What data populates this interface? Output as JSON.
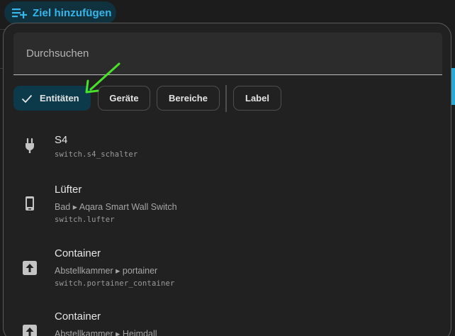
{
  "add_target_button": {
    "label": "Ziel hinzufügen",
    "icon": "playlist-plus-icon",
    "color": "#35b7ec"
  },
  "search": {
    "placeholder": "Durchsuchen"
  },
  "filter_chips": [
    {
      "label": "Entitäten",
      "selected": true
    },
    {
      "label": "Geräte",
      "selected": false
    },
    {
      "label": "Bereiche",
      "selected": false
    },
    {
      "label": "Label",
      "selected": false
    }
  ],
  "results": [
    {
      "name": "S4",
      "subtitle": "",
      "entity_id": "switch.s4_schalter",
      "icon": "power-plug-icon"
    },
    {
      "name": "Lüfter",
      "subtitle": "Bad ▸ Aqara Smart Wall Switch",
      "entity_id": "switch.lufter",
      "icon": "cellphone-icon"
    },
    {
      "name": "Container",
      "subtitle": "Abstellkammer ▸ portainer",
      "entity_id": "switch.portainer_container",
      "icon": "arrow-up-box-icon"
    },
    {
      "name": "Container",
      "subtitle": "Abstellkammer ▸ Heimdall",
      "entity_id": "",
      "icon": "arrow-up-box-icon"
    }
  ],
  "annotation_arrow": {
    "color": "#49e22a"
  },
  "colors": {
    "accent": "#35b7ec",
    "selected_chip_bg": "#0c3a4b",
    "panel_bg": "#212121"
  }
}
